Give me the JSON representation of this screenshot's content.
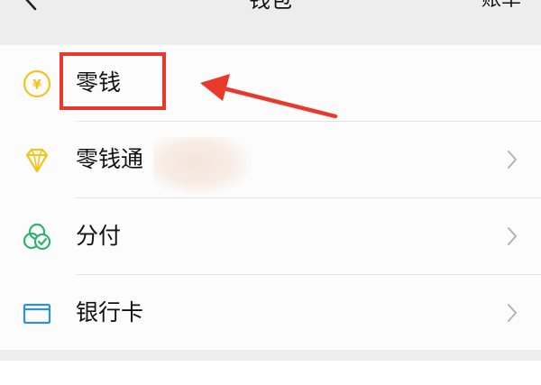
{
  "header": {
    "title": "钱包",
    "bill_label": "账单",
    "back_icon": "chevron-left-icon"
  },
  "wallet": {
    "items": [
      {
        "label": "零钱",
        "icon": "yen-coin-icon",
        "icon_color": "#f2c51e",
        "has_chevron": false
      },
      {
        "label": "零钱通",
        "icon": "diamond-icon",
        "icon_color": "#f2c51e",
        "has_chevron": true
      },
      {
        "label": "分付",
        "icon": "leaf-check-icon",
        "icon_color": "#2fb36b",
        "has_chevron": true
      },
      {
        "label": "银行卡",
        "icon": "bank-card-icon",
        "icon_color": "#2f8fd8",
        "has_chevron": true
      }
    ]
  },
  "annotation": {
    "highlight_color": "#e8392b"
  }
}
